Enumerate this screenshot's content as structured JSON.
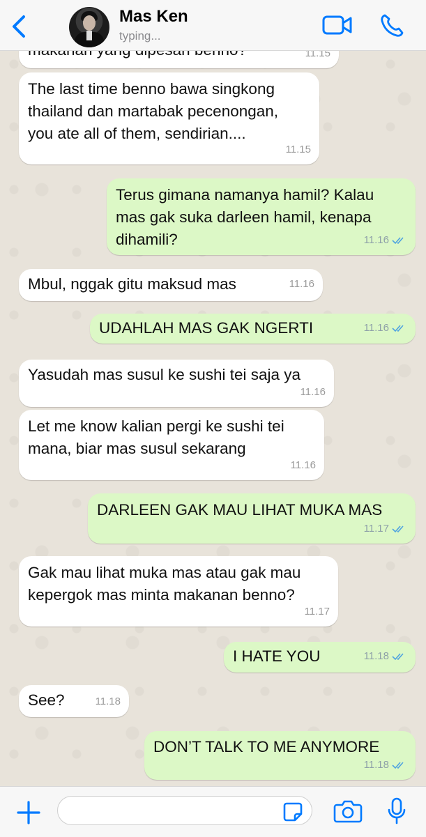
{
  "header": {
    "contact_name": "Mas Ken",
    "status": "typing...",
    "icons": {
      "back": "chevron-left-icon",
      "video": "video-camera-icon",
      "call": "phone-icon"
    }
  },
  "colors": {
    "accent": "#007aff",
    "incoming_bubble": "#ffffff",
    "outgoing_bubble": "#dcf8c6",
    "read_ticks": "#4fa3e0",
    "chat_background": "#e8e3da"
  },
  "messages": [
    {
      "direction": "in",
      "text": "makanan yang dipesan benno?",
      "time": "11.15"
    },
    {
      "direction": "in",
      "text": "The last time benno bawa singkong\nthailand dan martabak pecenongan,\nyou ate all of them, sendirian....",
      "time": "11.15"
    },
    {
      "direction": "out",
      "text": "Terus gimana namanya hamil? Kalau\nmas gak suka darleen hamil, kenapa\ndihamili?",
      "time": "11.16",
      "status": "read"
    },
    {
      "direction": "in",
      "text": "Mbul, nggak gitu maksud mas",
      "time": "11.16"
    },
    {
      "direction": "out",
      "text": "UDAHLAH MAS GAK NGERTI",
      "time": "11.16",
      "status": "read"
    },
    {
      "direction": "in",
      "text": "Yasudah mas susul ke sushi tei saja ya",
      "time": "11.16"
    },
    {
      "direction": "in",
      "text": "Let me know kalian pergi ke sushi tei\nmana, biar mas susul sekarang",
      "time": "11.16"
    },
    {
      "direction": "out",
      "text": "DARLEEN GAK MAU LIHAT MUKA MAS",
      "time": "11.17",
      "status": "read"
    },
    {
      "direction": "in",
      "text": "Gak mau lihat muka mas atau gak mau\nkepergok mas minta makanan benno?",
      "time": "11.17"
    },
    {
      "direction": "out",
      "text": "I HATE YOU",
      "time": "11.18",
      "status": "read"
    },
    {
      "direction": "in",
      "text": "See?",
      "time": "11.18"
    },
    {
      "direction": "out",
      "text": "DON’T TALK TO ME ANYMORE",
      "time": "11.18",
      "status": "read"
    }
  ],
  "input": {
    "value": "",
    "placeholder": "",
    "icons": {
      "attach": "plus-icon",
      "sticker": "sticker-icon",
      "camera": "camera-icon",
      "mic": "microphone-icon"
    }
  }
}
